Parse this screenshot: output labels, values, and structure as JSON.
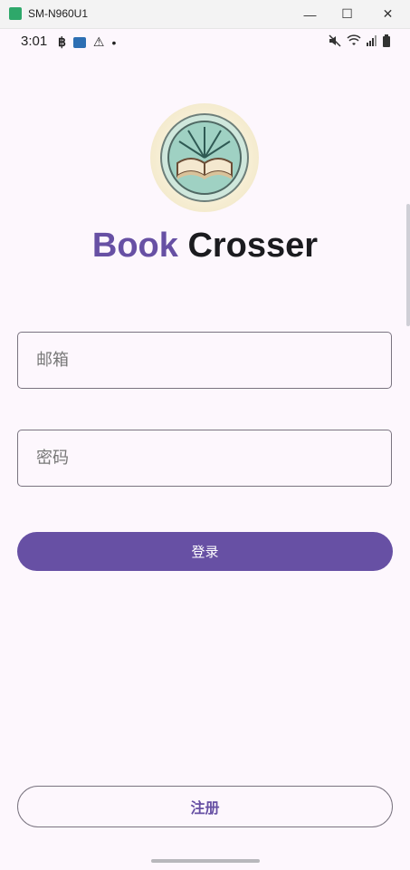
{
  "window": {
    "title": "SM-N960U1",
    "minimize_icon": "minimize-icon",
    "maximize_icon": "maximize-icon",
    "close_icon": "close-icon"
  },
  "statusbar": {
    "time": "3:01",
    "left_icons": [
      "b-app-icon",
      "image-icon",
      "warning-icon",
      "dot-icon"
    ],
    "right_icons": [
      "mute-icon",
      "wifi-icon",
      "signal-icon",
      "battery-icon"
    ]
  },
  "logo": {
    "icon": "open-book-logo-icon"
  },
  "brand": {
    "part1": "Book",
    "part2": " Crosser",
    "accent": "#6750a4"
  },
  "form": {
    "email_placeholder": "邮箱",
    "password_placeholder": "密码",
    "login_label": "登录"
  },
  "footer": {
    "register_label": "注册"
  }
}
